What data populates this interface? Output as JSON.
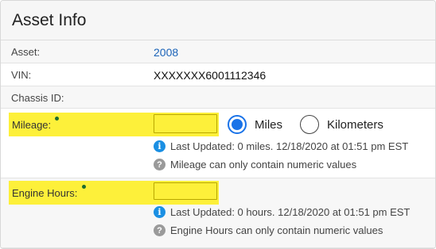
{
  "panel": {
    "title": "Asset Info"
  },
  "fields": {
    "asset": {
      "label": "Asset:",
      "value": "2008"
    },
    "vin": {
      "label": "VIN:",
      "value": "XXXXXXX6001112346"
    },
    "chassis": {
      "label": "Chassis ID:",
      "value": ""
    },
    "mileage": {
      "label": "Mileage:",
      "input_value": "",
      "unit_options": [
        "Miles",
        "Kilometers"
      ],
      "selected_unit": "Miles",
      "last_updated": "Last Updated: 0 miles. 12/18/2020 at 01:51 pm EST",
      "hint": "Mileage can only contain numeric values"
    },
    "engine_hours": {
      "label": "Engine Hours:",
      "input_value": "",
      "last_updated": "Last Updated: 0 hours. 12/18/2020 at 01:51 pm EST",
      "hint": "Engine Hours can only contain numeric values"
    }
  },
  "icons": {
    "info": "info-icon",
    "help": "help-icon",
    "required": "required-dot"
  },
  "colors": {
    "highlight": "#fdf03a",
    "link": "#1a63b8",
    "radio_selected": "#1a73e8",
    "info": "#1a8fe3",
    "required_dot": "#1e6b2d"
  }
}
